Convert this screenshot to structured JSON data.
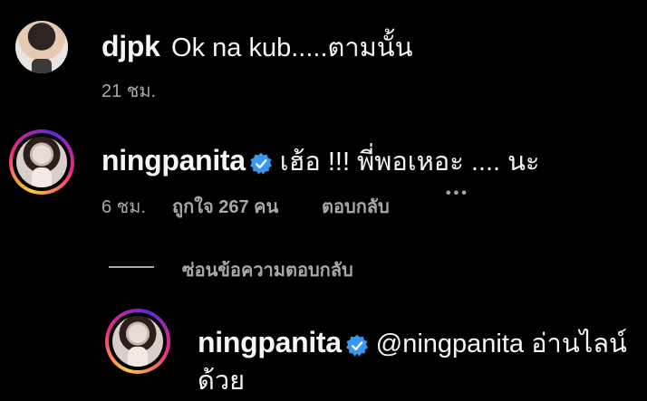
{
  "comments": [
    {
      "username": "djpk",
      "text": "Ok na kub.....ตามนั้น",
      "time": "21 ชม."
    },
    {
      "username": "ningpanita",
      "text": "เฮ้อ !!! พี่พอเหอะ .... นะ",
      "time": "6 ชม.",
      "likes": "ถูกใจ 267 คน",
      "reply_label": "ตอบกลับ",
      "more": "•••"
    }
  ],
  "replies_toggle": "ซ่อนข้อความตอบกลับ",
  "reply": {
    "username": "ningpanita",
    "text_line1": "@ningpanita อ่านไลน์",
    "text_line2": "ด้วย"
  },
  "colors": {
    "background": "#000000",
    "text": "#f5f5f5",
    "secondary": "#a8a8a8",
    "verified": "#3897f0"
  },
  "icons": [
    "verified-badge-icon",
    "more-options-icon"
  ]
}
